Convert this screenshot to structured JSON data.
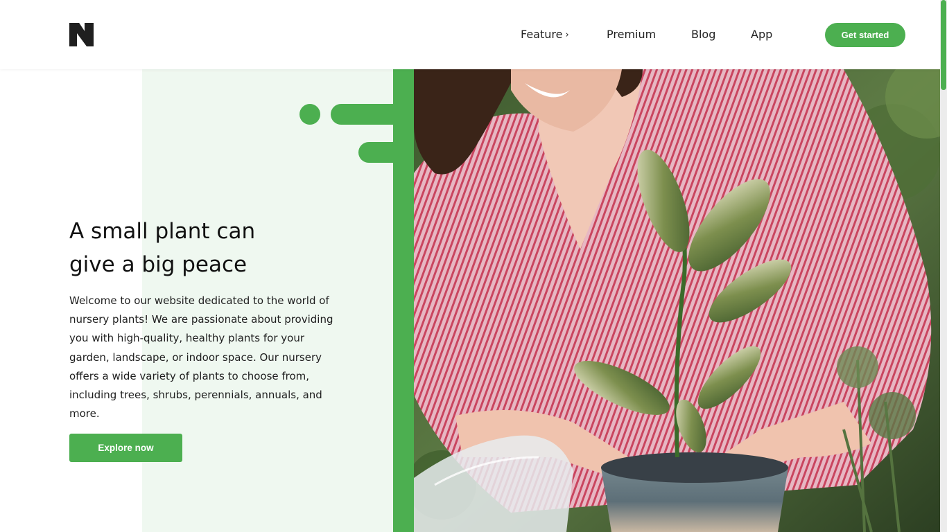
{
  "header": {
    "logo_icon": "n-logo-icon",
    "nav": [
      {
        "label": "Feature",
        "icon": "chevron-right-icon"
      },
      {
        "label": "Premium"
      },
      {
        "label": "Blog"
      },
      {
        "label": "App"
      }
    ],
    "cta_label": "Get started"
  },
  "hero": {
    "title_line1": "A small plant can",
    "title_line2": "give a big peace",
    "description": "Welcome to our website dedicated to the world of nursery plants! We are passionate about providing you with high-quality, healthy plants for your garden, landscape, or indoor space. Our nursery offers a wide variety of plants to choose from, including trees, shrubs, perennials, annuals, and more.",
    "button_label": "Explore now",
    "image": "woman-potting-plant-photo"
  },
  "colors": {
    "accent": "#4caf50",
    "tint": "#eff8f0",
    "text": "#111111"
  }
}
